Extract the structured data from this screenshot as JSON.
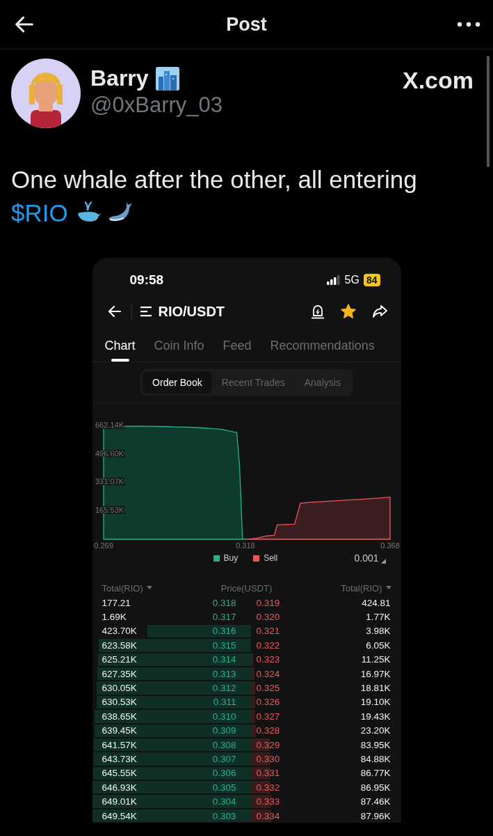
{
  "header": {
    "title": "Post"
  },
  "author": {
    "name": "Barry",
    "handle": "@0xBarry_03",
    "source": "X.com"
  },
  "tweet": {
    "text": "One whale after the other, all entering",
    "cashtag": "$RIO"
  },
  "screenshot": {
    "status_bar": {
      "time": "09:58",
      "network": "5G",
      "battery": "84"
    },
    "pair": "RIO/USDT",
    "favorite": true,
    "tabs": [
      {
        "label": "Chart",
        "selected": true
      },
      {
        "label": "Coin Info",
        "selected": false
      },
      {
        "label": "Feed",
        "selected": false
      },
      {
        "label": "Recommendations",
        "selected": false
      }
    ],
    "segments": [
      {
        "label": "Order Book",
        "selected": true
      },
      {
        "label": "Recent Trades",
        "selected": false
      },
      {
        "label": "Analysis",
        "selected": false
      }
    ],
    "chart_data": {
      "type": "area",
      "x": [
        0.269,
        0.28,
        0.29,
        0.3,
        0.305,
        0.31,
        0.314,
        0.315,
        0.316,
        0.317,
        0.318,
        0.32,
        0.322,
        0.325,
        0.328,
        0.329,
        0.335,
        0.337,
        0.34,
        0.35,
        0.36,
        0.368
      ],
      "series": [
        {
          "name": "Buy",
          "color": "#1fb58a",
          "values": [
            657000,
            660000,
            657000,
            652000,
            647000,
            640000,
            625000,
            624000,
            424000,
            2000,
            0,
            null,
            null,
            null,
            null,
            null,
            null,
            null,
            null,
            null,
            null,
            null
          ]
        },
        {
          "name": "Sell",
          "color": "#f0575c",
          "values": [
            null,
            null,
            null,
            null,
            null,
            null,
            null,
            null,
            null,
            null,
            0,
            2000,
            6000,
            19000,
            23000,
            84000,
            88000,
            210000,
            215000,
            225000,
            235000,
            245000
          ]
        }
      ],
      "xlim": [
        0.269,
        0.368
      ],
      "ylim": [
        0,
        662140
      ],
      "xticks": [
        0.269,
        0.318,
        0.368
      ],
      "yticks": [
        {
          "value": 165530,
          "label": "165.53K"
        },
        {
          "value": 331070,
          "label": "331.07K"
        },
        {
          "value": 496600,
          "label": "496.60K"
        },
        {
          "value": 662140,
          "label": "662.14K"
        }
      ]
    },
    "precision": "0.001",
    "columns": [
      {
        "label": "Total(RIO)",
        "sortable": true
      },
      {
        "label": "Price(USDT)",
        "sortable": false
      },
      {
        "label": "Total(RIO)",
        "sortable": true
      }
    ],
    "rows": [
      {
        "bid": {
          "total": "177.21",
          "price": "0.318"
        },
        "ask": {
          "price": "0.319",
          "total": "424.81"
        }
      },
      {
        "bid": {
          "total": "1.69K",
          "price": "0.317"
        },
        "ask": {
          "price": "0.320",
          "total": "1.77K"
        }
      },
      {
        "bid": {
          "total": "423.70K",
          "price": "0.316"
        },
        "ask": {
          "price": "0.321",
          "total": "3.98K"
        }
      },
      {
        "bid": {
          "total": "623.58K",
          "price": "0.315"
        },
        "ask": {
          "price": "0.322",
          "total": "6.05K"
        }
      },
      {
        "bid": {
          "total": "625.21K",
          "price": "0.314"
        },
        "ask": {
          "price": "0.323",
          "total": "11.25K"
        }
      },
      {
        "bid": {
          "total": "627.35K",
          "price": "0.313"
        },
        "ask": {
          "price": "0.324",
          "total": "16.97K"
        }
      },
      {
        "bid": {
          "total": "630.05K",
          "price": "0.312"
        },
        "ask": {
          "price": "0.325",
          "total": "18.81K"
        }
      },
      {
        "bid": {
          "total": "630.53K",
          "price": "0.311"
        },
        "ask": {
          "price": "0.326",
          "total": "19.10K"
        }
      },
      {
        "bid": {
          "total": "638.65K",
          "price": "0.310"
        },
        "ask": {
          "price": "0.327",
          "total": "19.43K"
        }
      },
      {
        "bid": {
          "total": "639.45K",
          "price": "0.309"
        },
        "ask": {
          "price": "0.328",
          "total": "23.20K"
        }
      },
      {
        "bid": {
          "total": "641.57K",
          "price": "0.308"
        },
        "ask": {
          "price": "0.329",
          "total": "83.95K"
        }
      },
      {
        "bid": {
          "total": "643.73K",
          "price": "0.307"
        },
        "ask": {
          "price": "0.330",
          "total": "84.88K"
        }
      },
      {
        "bid": {
          "total": "645.55K",
          "price": "0.306"
        },
        "ask": {
          "price": "0.331",
          "total": "86.77K"
        }
      },
      {
        "bid": {
          "total": "646.93K",
          "price": "0.305"
        },
        "ask": {
          "price": "0.332",
          "total": "86.95K"
        }
      },
      {
        "bid": {
          "total": "649.01K",
          "price": "0.304"
        },
        "ask": {
          "price": "0.333",
          "total": "87.46K"
        }
      },
      {
        "bid": {
          "total": "649.54K",
          "price": "0.303"
        },
        "ask": {
          "price": "0.334",
          "total": "87.96K"
        }
      }
    ]
  }
}
